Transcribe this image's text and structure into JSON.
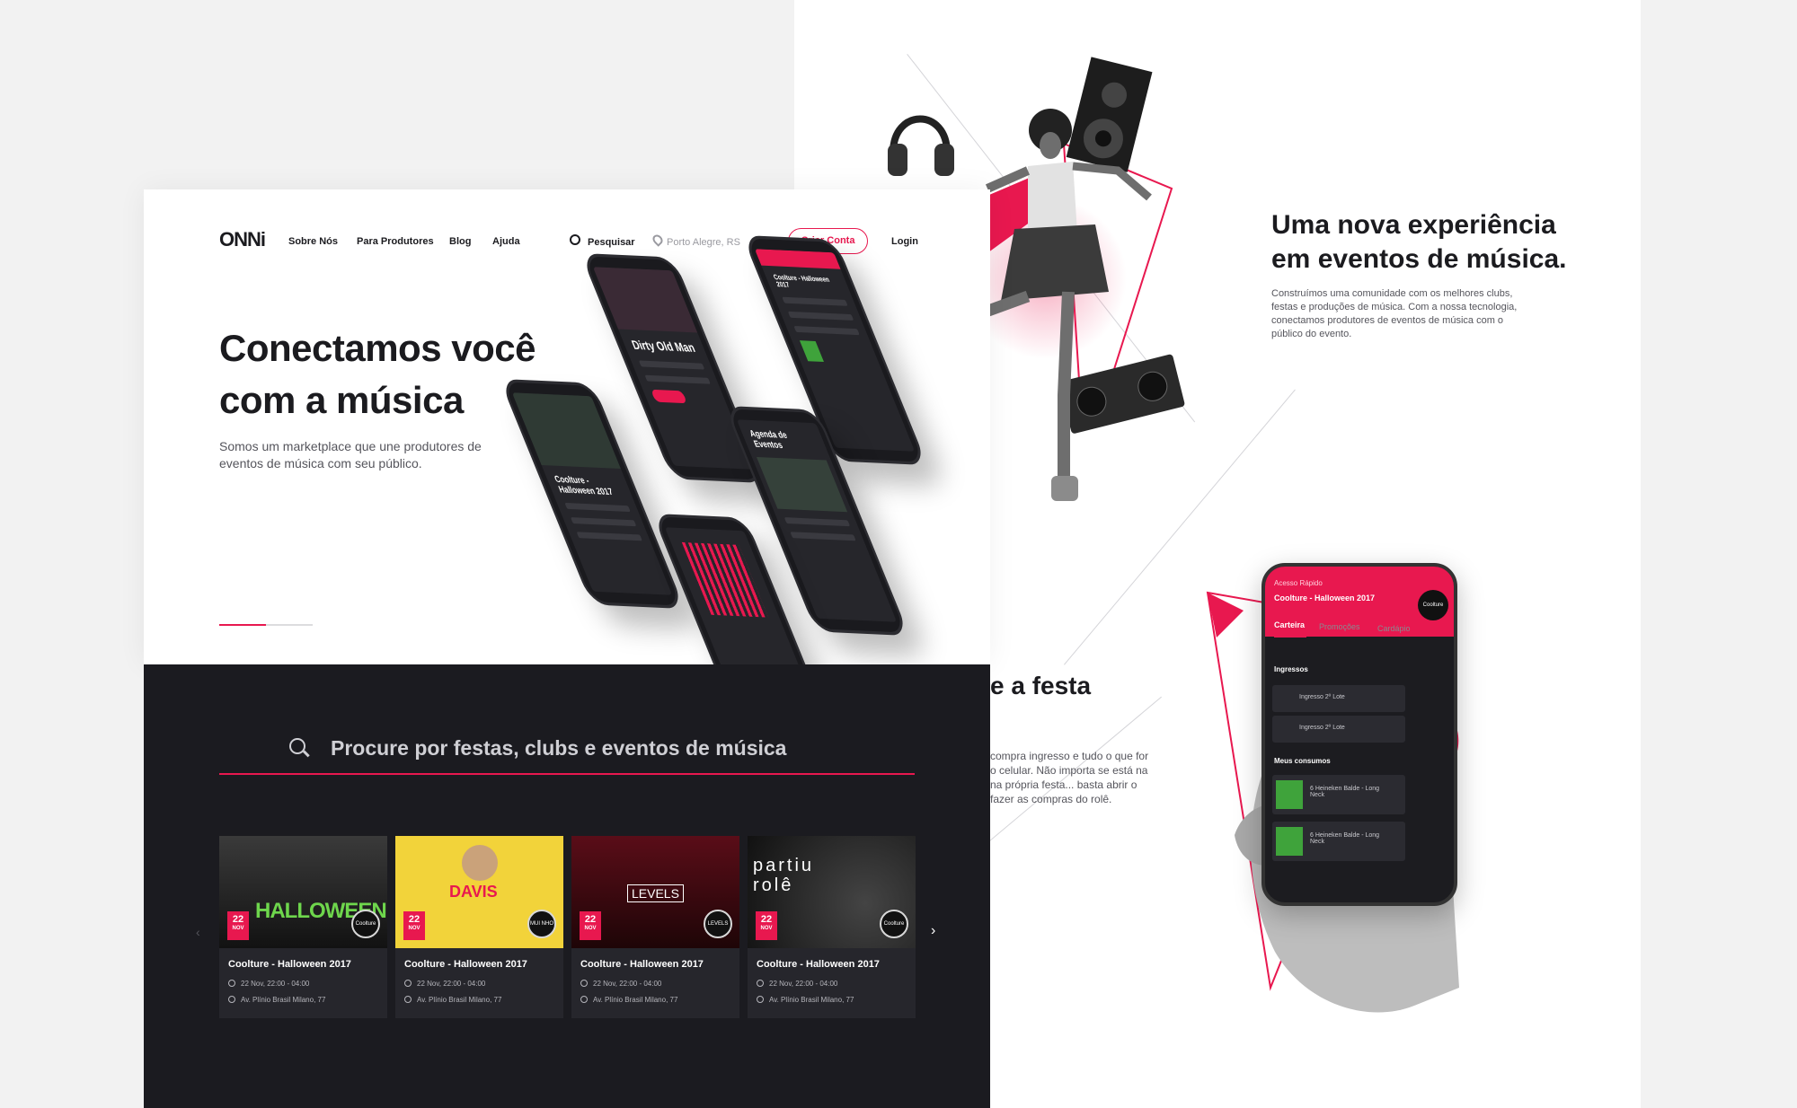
{
  "brand": {
    "logo_text": "ONNi",
    "accent": "#e8184f",
    "dark": "#1b1b20"
  },
  "nav": {
    "items": [
      "Sobre Nós",
      "Para Produtores",
      "Blog",
      "Ajuda"
    ],
    "search_label": "Pesquisar",
    "location": "Porto Alegre, RS",
    "create_account": "Criar Conta",
    "login": "Login"
  },
  "hero": {
    "title": "Conectamos você com a música",
    "subtitle": "Somos um marketplace que une produtores de eventos de música com seu público."
  },
  "phones": {
    "p1_title": "Dirty Old Man",
    "p2_header": "Coolture - Halloween 2017",
    "p3_title": "Coolture - Halloween 2017",
    "p4_title": "Agenda de Eventos"
  },
  "search": {
    "placeholder": "Procure por festas, clubs e eventos de música"
  },
  "events": [
    {
      "title": "Coolture - Halloween 2017",
      "day": "22",
      "month": "NOV",
      "time": "22 Nov, 22:00 - 04:00",
      "address": "Av. Plínio Brasil Milano, 77",
      "art": "HALLOWEEN",
      "logo": "Coolture"
    },
    {
      "title": "Coolture - Halloween 2017",
      "day": "22",
      "month": "NOV",
      "time": "22 Nov, 22:00 - 04:00",
      "address": "Av. Plínio Brasil Milano, 77",
      "art": "DAVIS",
      "logo": "MUI NHO"
    },
    {
      "title": "Coolture - Halloween 2017",
      "day": "22",
      "month": "NOV",
      "time": "22 Nov, 22:00 - 04:00",
      "address": "Av. Plínio Brasil Milano, 77",
      "art": "LEVELS",
      "logo": "LEVELS"
    },
    {
      "title": "Coolture - Halloween 2017",
      "day": "22",
      "month": "NOV",
      "time": "22 Nov, 22:00 - 04:00",
      "address": "Av. Plínio Brasil Milano, 77",
      "art": "partiu rolê",
      "logo": "Coolture"
    }
  ],
  "experience": {
    "title": "Uma nova experiência em eventos de música.",
    "body": "Construímos uma comunidade com os melhores clubs, festas e produções de música. Com a nossa tecnologia, conectamos produtores de eventos de música com o público do evento."
  },
  "party": {
    "title_fragment": "e a festa",
    "body_lines": [
      "compra ingresso e tudo o que for",
      "o celular. Não importa se está na",
      "na própria festa... basta abrir o",
      "fazer as compras do rolê."
    ]
  },
  "app": {
    "quick_access": "Acesso Rápido",
    "event": "Coolture - Halloween 2017",
    "tabs": [
      "Carteira",
      "Promoções",
      "Cardápio"
    ],
    "tickets_label": "Ingressos",
    "tickets": [
      "Ingresso 2º Lote",
      "Ingresso 2º Lote"
    ],
    "consumos_label": "Meus consumos",
    "consumos": [
      "6 Heineken Balde - Long Neck",
      "6 Heineken Balde - Long Neck"
    ],
    "badge": "Coolture"
  }
}
